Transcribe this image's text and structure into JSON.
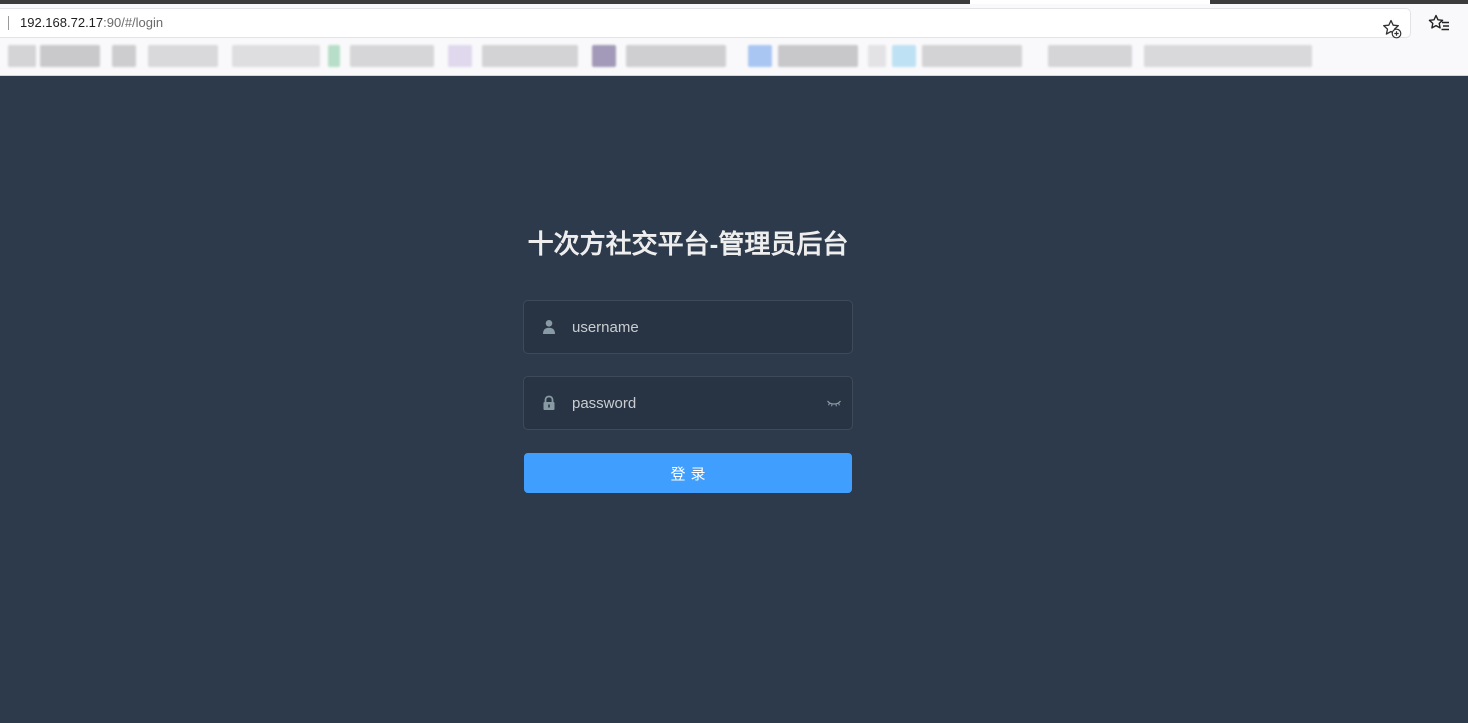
{
  "browser": {
    "url_host": "192.168.72.17",
    "url_rest": ":90/#/login",
    "icons": {
      "add_favorite": "star-plus-icon",
      "favorites": "favorites-list-icon"
    },
    "bookmarks_bar_note": "bookmark entries are pixelated/unreadable"
  },
  "login": {
    "title": "十次方社交平台-管理员后台",
    "username_placeholder": "username",
    "username_value": "",
    "password_placeholder": "password",
    "password_value": "",
    "submit_label": "登录",
    "icons": {
      "username": "user-icon",
      "password": "lock-icon",
      "toggle_password": "eye-closed-icon"
    }
  },
  "colors": {
    "page_background": "#2d3a4b",
    "input_background": "#283443",
    "primary_button": "#409eff",
    "title_text": "#eeeeee"
  }
}
